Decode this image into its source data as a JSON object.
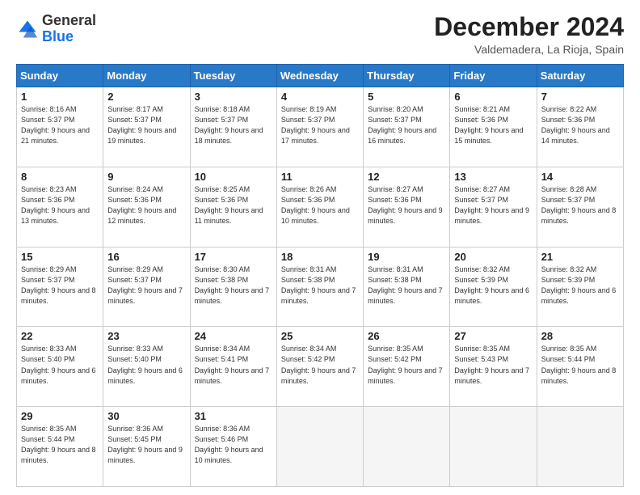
{
  "header": {
    "logo_line1": "General",
    "logo_line2": "Blue",
    "month": "December 2024",
    "location": "Valdemadera, La Rioja, Spain"
  },
  "weekdays": [
    "Sunday",
    "Monday",
    "Tuesday",
    "Wednesday",
    "Thursday",
    "Friday",
    "Saturday"
  ],
  "weeks": [
    [
      {
        "day": 1,
        "sunrise": "8:16 AM",
        "sunset": "5:37 PM",
        "daylight": "9 hours and 21 minutes."
      },
      {
        "day": 2,
        "sunrise": "8:17 AM",
        "sunset": "5:37 PM",
        "daylight": "9 hours and 19 minutes."
      },
      {
        "day": 3,
        "sunrise": "8:18 AM",
        "sunset": "5:37 PM",
        "daylight": "9 hours and 18 minutes."
      },
      {
        "day": 4,
        "sunrise": "8:19 AM",
        "sunset": "5:37 PM",
        "daylight": "9 hours and 17 minutes."
      },
      {
        "day": 5,
        "sunrise": "8:20 AM",
        "sunset": "5:37 PM",
        "daylight": "9 hours and 16 minutes."
      },
      {
        "day": 6,
        "sunrise": "8:21 AM",
        "sunset": "5:36 PM",
        "daylight": "9 hours and 15 minutes."
      },
      {
        "day": 7,
        "sunrise": "8:22 AM",
        "sunset": "5:36 PM",
        "daylight": "9 hours and 14 minutes."
      }
    ],
    [
      {
        "day": 8,
        "sunrise": "8:23 AM",
        "sunset": "5:36 PM",
        "daylight": "9 hours and 13 minutes."
      },
      {
        "day": 9,
        "sunrise": "8:24 AM",
        "sunset": "5:36 PM",
        "daylight": "9 hours and 12 minutes."
      },
      {
        "day": 10,
        "sunrise": "8:25 AM",
        "sunset": "5:36 PM",
        "daylight": "9 hours and 11 minutes."
      },
      {
        "day": 11,
        "sunrise": "8:26 AM",
        "sunset": "5:36 PM",
        "daylight": "9 hours and 10 minutes."
      },
      {
        "day": 12,
        "sunrise": "8:27 AM",
        "sunset": "5:36 PM",
        "daylight": "9 hours and 9 minutes."
      },
      {
        "day": 13,
        "sunrise": "8:27 AM",
        "sunset": "5:37 PM",
        "daylight": "9 hours and 9 minutes."
      },
      {
        "day": 14,
        "sunrise": "8:28 AM",
        "sunset": "5:37 PM",
        "daylight": "9 hours and 8 minutes."
      }
    ],
    [
      {
        "day": 15,
        "sunrise": "8:29 AM",
        "sunset": "5:37 PM",
        "daylight": "9 hours and 8 minutes."
      },
      {
        "day": 16,
        "sunrise": "8:29 AM",
        "sunset": "5:37 PM",
        "daylight": "9 hours and 7 minutes."
      },
      {
        "day": 17,
        "sunrise": "8:30 AM",
        "sunset": "5:38 PM",
        "daylight": "9 hours and 7 minutes."
      },
      {
        "day": 18,
        "sunrise": "8:31 AM",
        "sunset": "5:38 PM",
        "daylight": "9 hours and 7 minutes."
      },
      {
        "day": 19,
        "sunrise": "8:31 AM",
        "sunset": "5:38 PM",
        "daylight": "9 hours and 7 minutes."
      },
      {
        "day": 20,
        "sunrise": "8:32 AM",
        "sunset": "5:39 PM",
        "daylight": "9 hours and 6 minutes."
      },
      {
        "day": 21,
        "sunrise": "8:32 AM",
        "sunset": "5:39 PM",
        "daylight": "9 hours and 6 minutes."
      }
    ],
    [
      {
        "day": 22,
        "sunrise": "8:33 AM",
        "sunset": "5:40 PM",
        "daylight": "9 hours and 6 minutes."
      },
      {
        "day": 23,
        "sunrise": "8:33 AM",
        "sunset": "5:40 PM",
        "daylight": "9 hours and 6 minutes."
      },
      {
        "day": 24,
        "sunrise": "8:34 AM",
        "sunset": "5:41 PM",
        "daylight": "9 hours and 7 minutes."
      },
      {
        "day": 25,
        "sunrise": "8:34 AM",
        "sunset": "5:42 PM",
        "daylight": "9 hours and 7 minutes."
      },
      {
        "day": 26,
        "sunrise": "8:35 AM",
        "sunset": "5:42 PM",
        "daylight": "9 hours and 7 minutes."
      },
      {
        "day": 27,
        "sunrise": "8:35 AM",
        "sunset": "5:43 PM",
        "daylight": "9 hours and 7 minutes."
      },
      {
        "day": 28,
        "sunrise": "8:35 AM",
        "sunset": "5:44 PM",
        "daylight": "9 hours and 8 minutes."
      }
    ],
    [
      {
        "day": 29,
        "sunrise": "8:35 AM",
        "sunset": "5:44 PM",
        "daylight": "9 hours and 8 minutes."
      },
      {
        "day": 30,
        "sunrise": "8:36 AM",
        "sunset": "5:45 PM",
        "daylight": "9 hours and 9 minutes."
      },
      {
        "day": 31,
        "sunrise": "8:36 AM",
        "sunset": "5:46 PM",
        "daylight": "9 hours and 10 minutes."
      },
      null,
      null,
      null,
      null
    ]
  ]
}
